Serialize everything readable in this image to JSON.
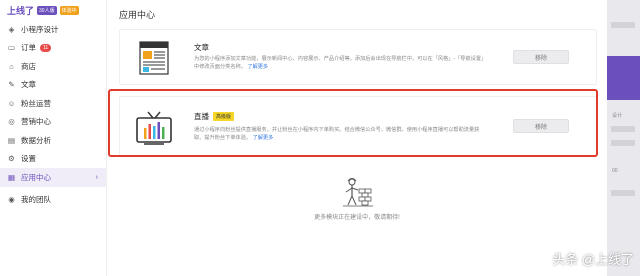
{
  "sidebar": {
    "brand": "上线了",
    "plan_badge": "30人版",
    "status_badge": "体验中",
    "items": [
      {
        "label": "小程序设计",
        "icon": "layers-icon"
      },
      {
        "label": "订单",
        "icon": "order-icon",
        "count": "11"
      },
      {
        "label": "商店",
        "icon": "store-icon"
      },
      {
        "label": "文章",
        "icon": "article-icon"
      },
      {
        "label": "粉丝运营",
        "icon": "fans-icon"
      },
      {
        "label": "营销中心",
        "icon": "marketing-icon"
      },
      {
        "label": "数据分析",
        "icon": "analytics-icon"
      },
      {
        "label": "设置",
        "icon": "settings-icon"
      },
      {
        "label": "应用中心",
        "icon": "app-center-icon",
        "active": true
      },
      {
        "label": "我的团队",
        "icon": "team-icon"
      }
    ]
  },
  "main": {
    "title": "应用中心",
    "cards": [
      {
        "title": "文章",
        "icon": "newspaper-icon",
        "desc": "为您的小程序添加文章功能，展示新闻中心、内容展示、产品介绍等。添加后会出现在导航栏中，可以在「风格」-「导航设置」中修改页面分类名称。",
        "link": "了解更多",
        "button": "移除"
      },
      {
        "title": "直播",
        "tag": "高级版",
        "icon": "live-tv-icon",
        "desc": "通过小程序向粉丝提供直播服务，并让粉丝在小程序内下单购买。结合微信公众号，微信群，使用小程序直播可以帮助流量获取、提升粉丝下单体验。",
        "link": "了解更多",
        "button": "移除"
      }
    ],
    "empty_text": "更多模块正在建设中，敬请期待!"
  },
  "right_strip": {
    "labels": [
      "设计",
      "00"
    ]
  },
  "watermark": "头条 @上线了",
  "colors": {
    "brand": "#6b4fbb",
    "highlight": "#e03a2a",
    "tag": "#f5d628",
    "link": "#3c7be0"
  }
}
